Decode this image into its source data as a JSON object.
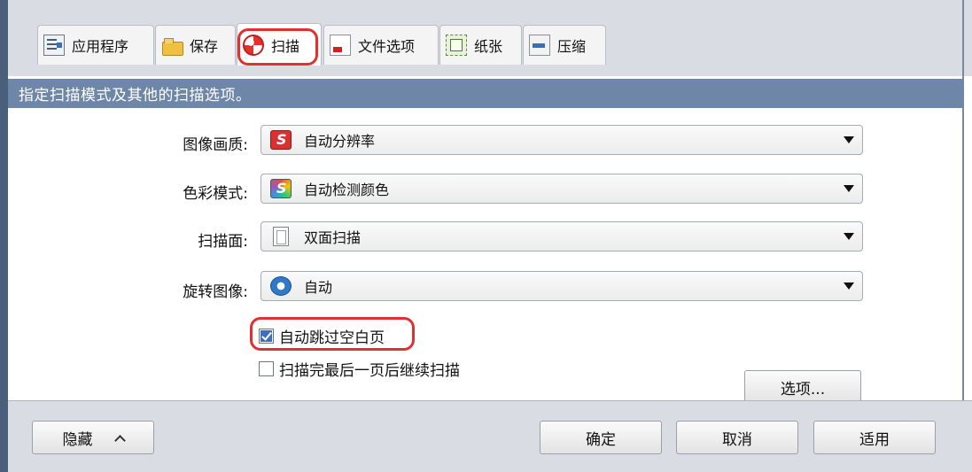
{
  "tabs": [
    {
      "label": "应用程序",
      "icon": "application-icon"
    },
    {
      "label": "保存",
      "icon": "folder-icon"
    },
    {
      "label": "扫描",
      "icon": "scan-icon",
      "active": true
    },
    {
      "label": "文件选项",
      "icon": "file-icon"
    },
    {
      "label": "纸张",
      "icon": "paper-icon"
    },
    {
      "label": "压缩",
      "icon": "compress-icon"
    }
  ],
  "description": "指定扫描模式及其他的扫描选项。",
  "fields": {
    "image_quality": {
      "label": "图像画质:",
      "value": "自动分辨率",
      "icon": "scansnap-icon"
    },
    "color_mode": {
      "label": "色彩模式:",
      "value": "自动检测颜色",
      "icon": "color-scansnap-icon"
    },
    "scanning_side": {
      "label": "扫描面:",
      "value": "双面扫描",
      "icon": "duplex-page-icon"
    },
    "rotation": {
      "label": "旋转图像:",
      "value": "自动",
      "icon": "rotate-icon"
    }
  },
  "checkboxes": {
    "skip_blank": {
      "label": "自动跳过空白页",
      "checked": true
    },
    "continue_scan": {
      "label": "扫描完最后一页后继续扫描",
      "checked": false
    }
  },
  "buttons": {
    "options": "选项...",
    "hide": "隐藏",
    "ok": "确定",
    "cancel": "取消",
    "apply": "适用"
  },
  "highlight_color": "#e03030",
  "header_color": "#6e87a8"
}
